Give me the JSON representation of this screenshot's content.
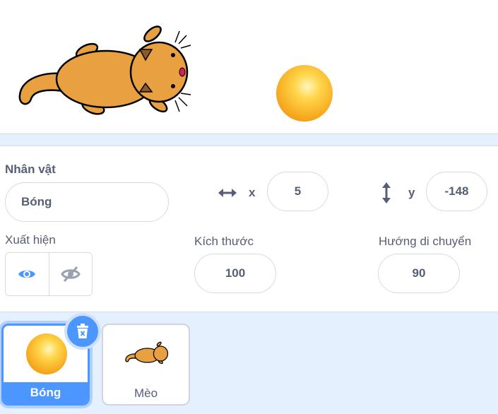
{
  "sprite_info": {
    "sprite_label": "Nhân vật",
    "sprite_name": "Bóng",
    "x_label": "x",
    "x_value": "5",
    "y_label": "y",
    "y_value": "-148",
    "show_label": "Xuất hiện",
    "size_label": "Kích thước",
    "size_value": "100",
    "direction_label": "Hướng di chuyển",
    "direction_value": "90"
  },
  "sprite_list": {
    "items": [
      {
        "name": "Bóng",
        "selected": true
      },
      {
        "name": "Mèo",
        "selected": false
      }
    ]
  },
  "icons": {
    "x_axis": "horizontal-arrows-icon",
    "y_axis": "vertical-arrows-icon",
    "show": "eye-icon",
    "hide": "eye-slash-icon",
    "delete": "trash-icon"
  },
  "colors": {
    "accent": "#4c97ff",
    "panel_bg": "#e5f0ff",
    "text": "#575e75"
  }
}
